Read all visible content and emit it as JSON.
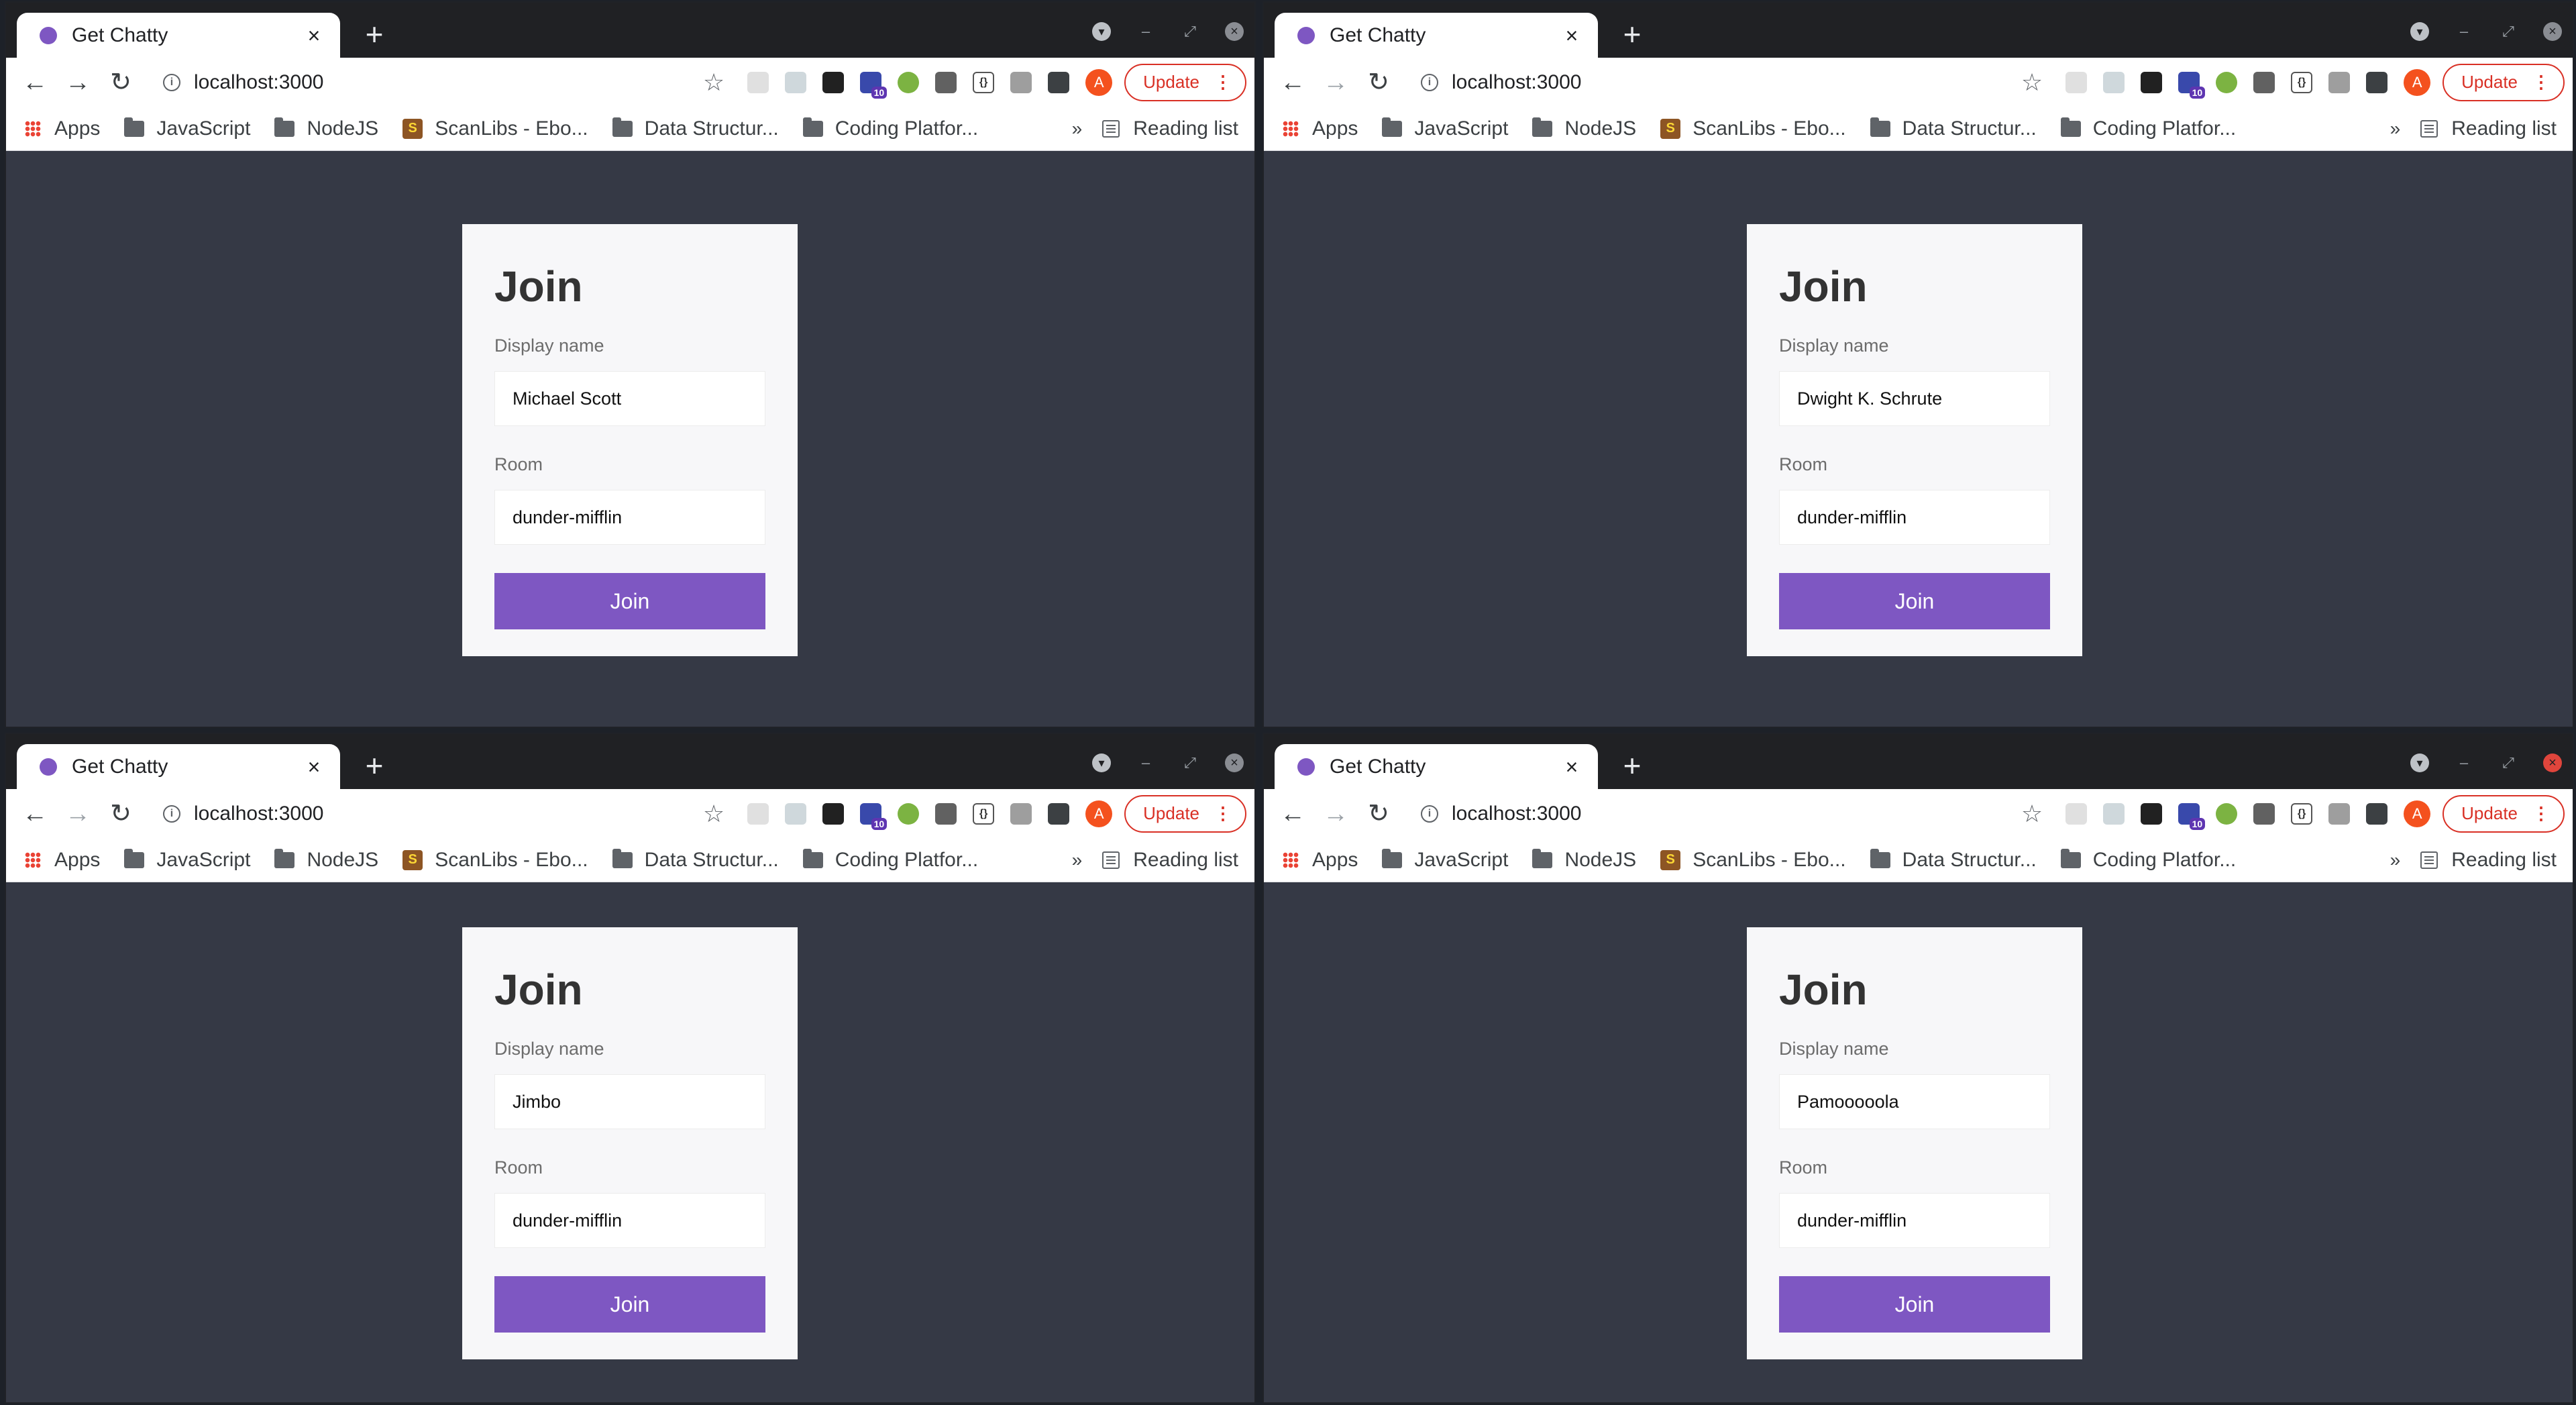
{
  "browser": {
    "tab_title": "Get Chatty",
    "tab_close": "×",
    "new_tab": "+",
    "url": "localhost:3000",
    "update_label": "Update",
    "avatar_letter": "A",
    "extension_badge": "10",
    "bookmarks": [
      {
        "label": "Apps",
        "icon": "apps-grid-icon"
      },
      {
        "label": "JavaScript",
        "icon": "folder-icon"
      },
      {
        "label": "NodeJS",
        "icon": "folder-icon"
      },
      {
        "label": "ScanLibs - Ebo...",
        "icon": "scanlibs-icon"
      },
      {
        "label": "Data Structur...",
        "icon": "folder-icon"
      },
      {
        "label": "Coding Platfor...",
        "icon": "folder-icon"
      }
    ],
    "bookmarks_overflow": "»",
    "reading_list": "Reading list"
  },
  "form": {
    "title": "Join",
    "display_name_label": "Display name",
    "room_label": "Room",
    "join_label": "Join"
  },
  "windows": [
    {
      "display_name": "Michael Scott",
      "room": "dunder-mifflin"
    },
    {
      "display_name": "Dwight K. Schrute",
      "room": "dunder-mifflin"
    },
    {
      "display_name": "Jimbo",
      "room": "dunder-mifflin"
    },
    {
      "display_name": "Pamooooola",
      "room": "dunder-mifflin"
    }
  ],
  "colors": {
    "page_background": "#353945",
    "card_background": "#f7f7f9",
    "accent": "#7e57c2",
    "update_red": "#d93025"
  }
}
